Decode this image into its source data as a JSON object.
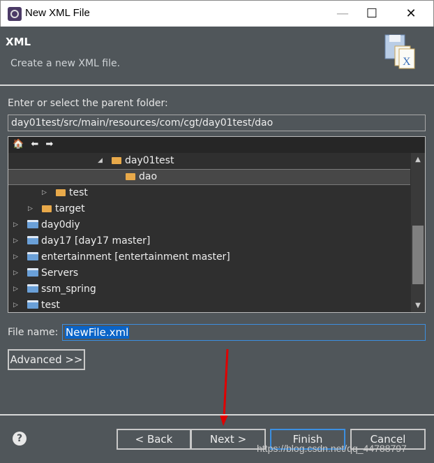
{
  "window": {
    "title": "New XML File",
    "minimize": "—",
    "maximize": "☐",
    "close": "✕"
  },
  "header": {
    "title": "XML",
    "description": "Create a new XML file."
  },
  "folder": {
    "label": "Enter or select the parent folder:",
    "value": "day01test/src/main/resources/com/cgt/day01test/dao"
  },
  "tree": {
    "toolbar": {
      "home": "🏠",
      "back": "⬅",
      "forward": "➡"
    },
    "items": [
      {
        "label": "day01test",
        "icon": "folder-open-icon",
        "expanded": true
      },
      {
        "label": "dao",
        "icon": "folder-open-icon",
        "selected": true
      },
      {
        "label": "test",
        "icon": "folder-icon"
      },
      {
        "label": "target",
        "icon": "folder-icon"
      },
      {
        "label": "day0diy",
        "icon": "project-icon"
      },
      {
        "label": "day17 [day17 master]",
        "icon": "project-icon"
      },
      {
        "label": "entertainment [entertainment master]",
        "icon": "project-icon"
      },
      {
        "label": "Servers",
        "icon": "project-icon"
      },
      {
        "label": "ssm_spring",
        "icon": "project-icon"
      },
      {
        "label": "test",
        "icon": "project-icon"
      }
    ]
  },
  "file": {
    "label": "File name:",
    "value": "NewFile.xml"
  },
  "buttons": {
    "advanced": "Advanced >>",
    "back": "< Back",
    "next": "Next >",
    "finish": "Finish",
    "cancel": "Cancel",
    "help": "?"
  },
  "watermark": "https://blog.csdn.net/qq_44788797",
  "colors": {
    "background": "#50565a",
    "selection": "#0a64c8",
    "annotation_arrow": "#e00000"
  }
}
